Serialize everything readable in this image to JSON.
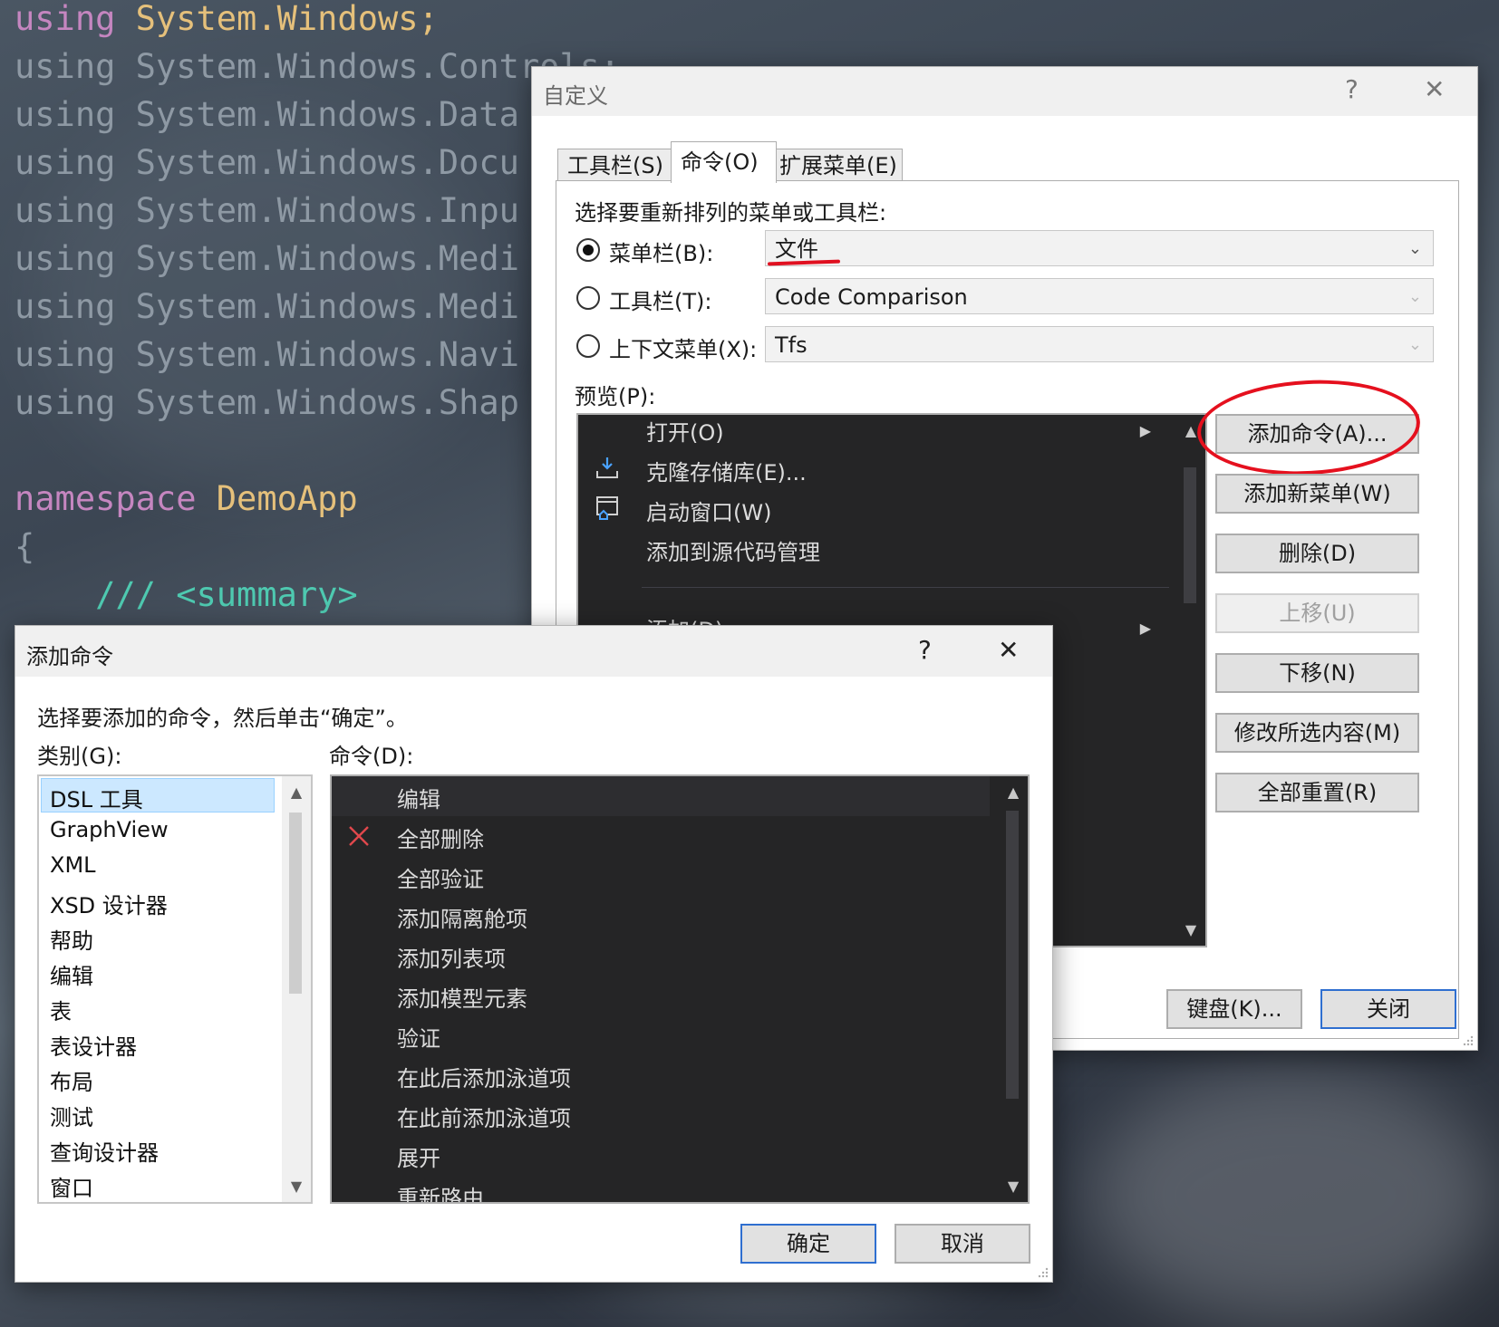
{
  "editor": {
    "lines": [
      {
        "kw": "using",
        "rest": " System.Windows;"
      },
      {
        "kw": "using",
        "rest": " System.Windows.Controls;"
      },
      {
        "kw": "using",
        "rest": " System.Windows.Data"
      },
      {
        "kw": "using",
        "rest": " System.Windows.Docu"
      },
      {
        "kw": "using",
        "rest": " System.Windows.Inpu"
      },
      {
        "kw": "using",
        "rest": " System.Windows.Medi"
      },
      {
        "kw": "using",
        "rest": " System.Windows.Medi"
      },
      {
        "kw": "using",
        "rest": " System.Windows.Navi"
      },
      {
        "kw": "using",
        "rest": " System.Windows.Shap"
      }
    ],
    "namespace_kw": "namespace",
    "namespace_name": "DemoApp",
    "brace": "{",
    "comment": "/// <summary>"
  },
  "customize": {
    "title": "自定义",
    "help": "?",
    "close": "✕",
    "tabs": [
      "工具栏(S)",
      "命令(O)",
      "扩展菜单(E)"
    ],
    "prompt": "选择要重新排列的菜单或工具栏:",
    "menubar_label": "菜单栏(B):",
    "menubar_value": "文件",
    "toolbar_label": "工具栏(T):",
    "toolbar_value": "Code Comparison",
    "context_label": "上下文菜单(X):",
    "context_value": "Tfs",
    "preview_label": "预览(P):",
    "preview_items": [
      "打开(O)",
      "克隆存储库(E)...",
      "启动窗口(W)",
      "添加到源代码管理",
      "添加(D)"
    ],
    "buttons": {
      "add_command": "添加命令(A)...",
      "add_menu": "添加新菜单(W)",
      "delete": "删除(D)",
      "move_up": "上移(U)",
      "move_down": "下移(N)",
      "modify": "修改所选内容(M)",
      "reset_all": "全部重置(R)",
      "keyboard": "键盘(K)...",
      "close": "关闭"
    }
  },
  "add_command": {
    "title": "添加命令",
    "help": "?",
    "close": "✕",
    "prompt": "选择要添加的命令，然后单击“确定”。",
    "category_label": "类别(G):",
    "command_label": "命令(D):",
    "categories": [
      "DSL 工具",
      "GraphView",
      "XML",
      "XSD 设计器",
      "帮助",
      "编辑",
      "表",
      "表设计器",
      "布局",
      "测试",
      "查询设计器",
      "窗口"
    ],
    "selected_category": "DSL 工具",
    "commands": [
      "编辑",
      "全部删除",
      "全部验证",
      "添加隔离舱项",
      "添加列表项",
      "添加模型元素",
      "验证",
      "在此后添加泳道项",
      "在此前添加泳道项",
      "展开",
      "重新路由"
    ],
    "ok": "确定",
    "cancel": "取消"
  },
  "colors": {
    "accent_red": "#e5101e",
    "selection": "#cce8ff",
    "dark_panel": "#252526"
  }
}
